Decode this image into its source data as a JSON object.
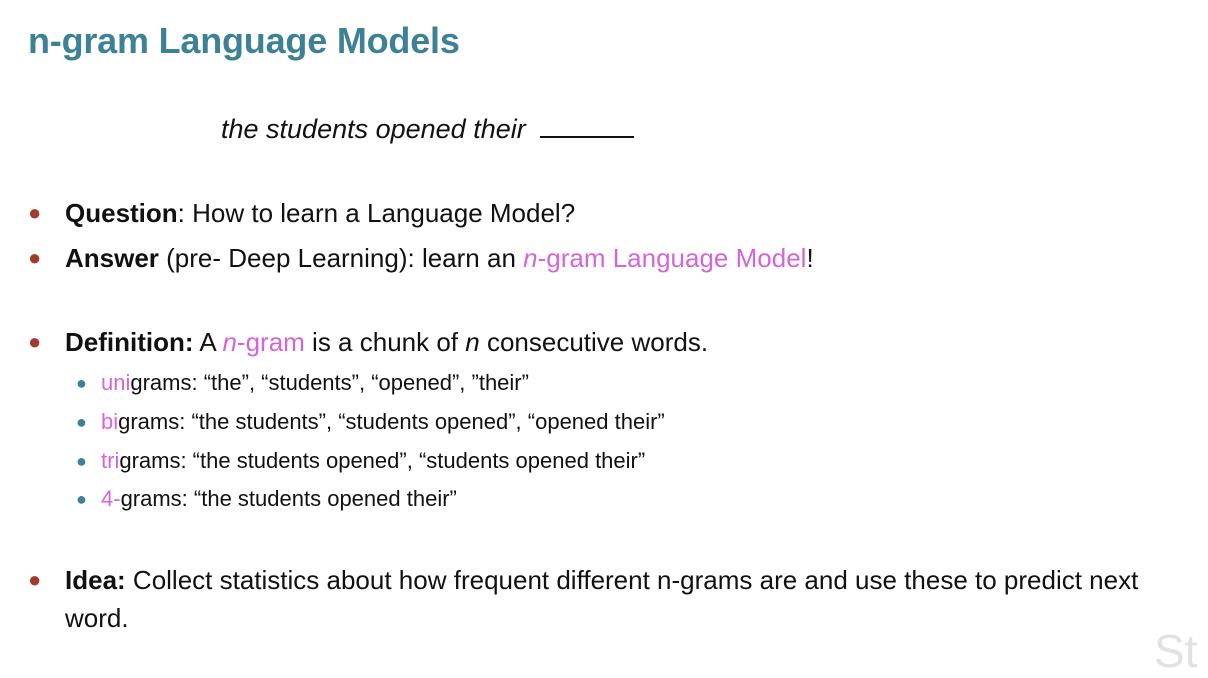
{
  "slide": {
    "title": "n-gram Language Models",
    "example": {
      "text": "the students opened their"
    },
    "bullets": {
      "question": {
        "label": "Question",
        "text": ": How to learn a Language Model?"
      },
      "answer": {
        "label": "Answer",
        "text_pre": " (pre- Deep Learning): learn an ",
        "highlight_n": "n",
        "highlight_rest": "-gram Language Model",
        "text_post": "!"
      },
      "definition": {
        "label": "Definition:",
        "text_a": " A ",
        "highlight_n": "n",
        "highlight_rest": "-gram",
        "text_b": " is a chunk of ",
        "italic_n": "n",
        "text_c": " consecutive words."
      },
      "sub_items": [
        {
          "prefix": "uni",
          "rest": "grams: “the”, “students”, “opened”, ”their”"
        },
        {
          "prefix": "bi",
          "rest": "grams: “the students”, “students opened”, “opened their”"
        },
        {
          "prefix": "tri",
          "rest": "grams: “the students opened”, “students opened their”"
        },
        {
          "prefix": "4-",
          "rest": "grams: “the students opened their”"
        }
      ],
      "idea": {
        "label": "Idea:",
        "text": " Collect statistics about how frequent different n-grams are and use these to predict next word."
      }
    },
    "watermark": "St"
  },
  "colors": {
    "title": "#3d8197",
    "highlight": "#d564d9",
    "bullet_main": "#a33a2e",
    "bullet_sub": "#3d8197"
  }
}
